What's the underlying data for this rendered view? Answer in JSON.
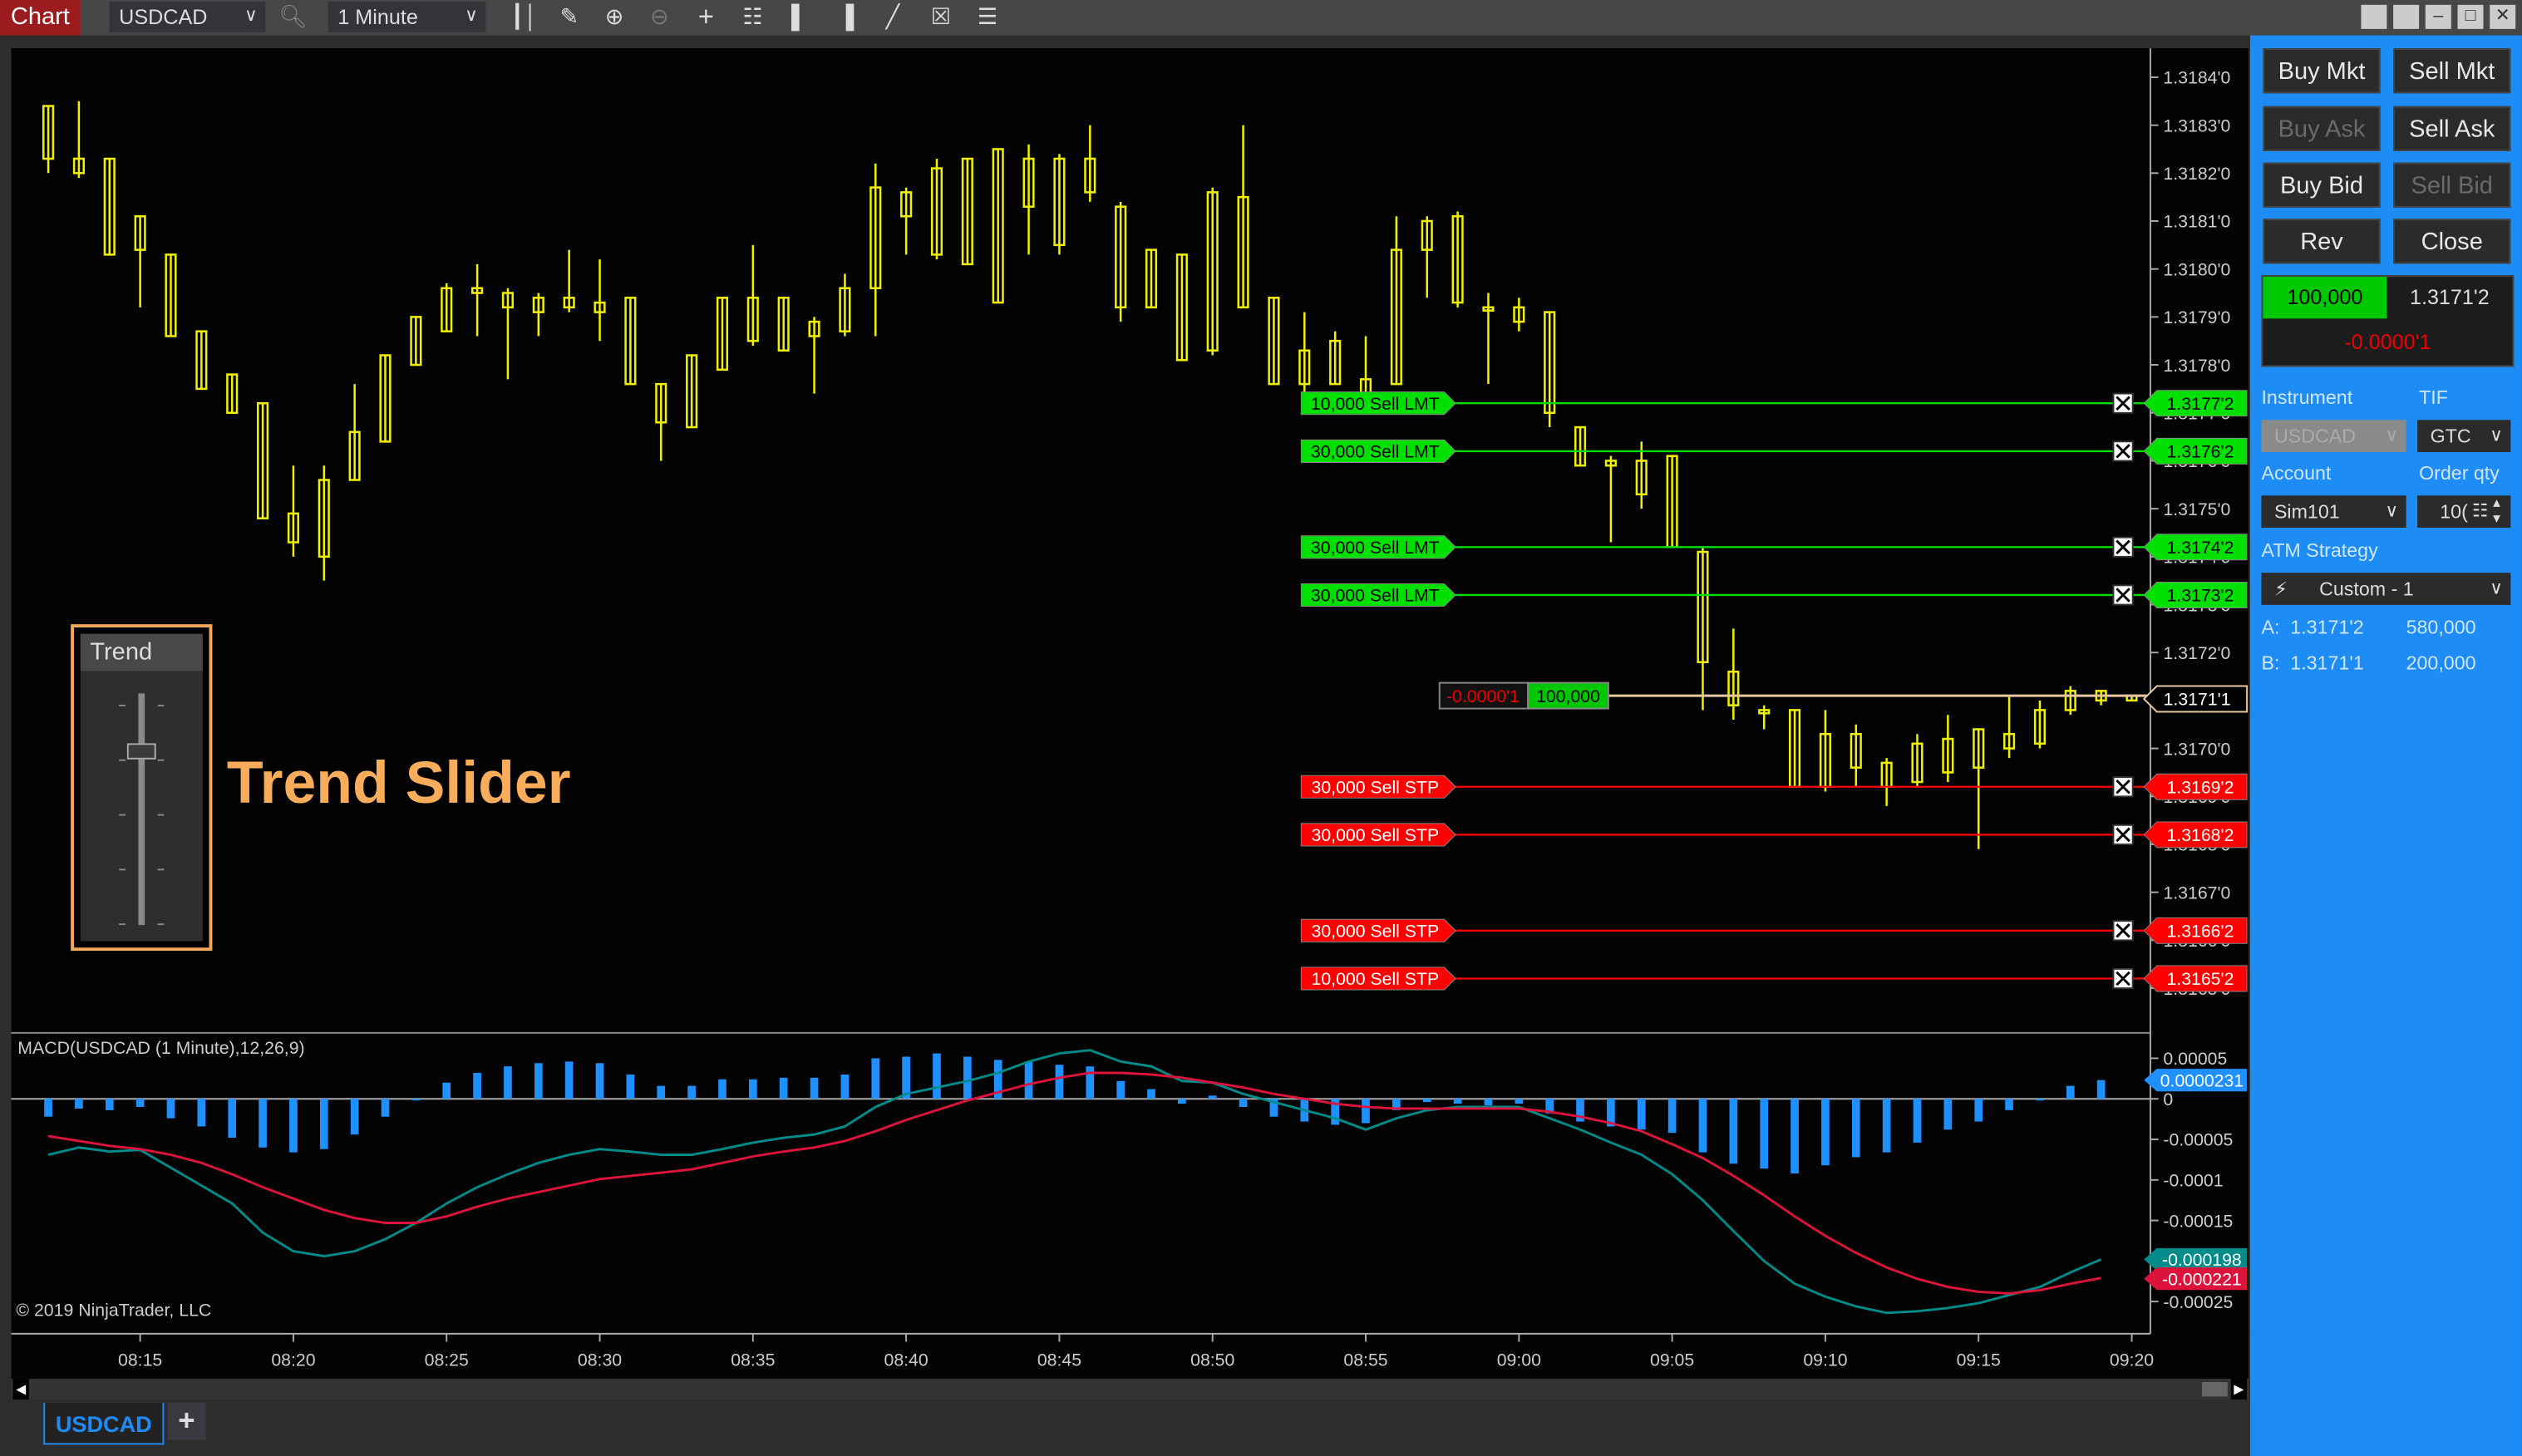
{
  "toolbar": {
    "chart_label": "Chart",
    "instrument": "USDCAD",
    "interval": "1 Minute",
    "icons": [
      "search-icon",
      "bars-type-icon",
      "drawing-tool-icon",
      "zoom-in-icon",
      "zoom-out-icon",
      "crosshair-icon",
      "properties-icon",
      "trade-panel-icon",
      "data-box-icon",
      "strategies-icon",
      "templates-icon",
      "indicator-list-icon"
    ],
    "window_buttons": [
      "tile-icon",
      "always-on-top-icon",
      "minimize-icon",
      "maximize-icon",
      "close-icon"
    ]
  },
  "colors": {
    "candle": "#f0f000",
    "sell_limit": "#00e000",
    "sell_stop": "#ff0000",
    "position_line": "#e6c8a0",
    "macd": "#008b8b",
    "signal": "#dc143c",
    "histogram": "#1e90ff",
    "panel": "#1e8cf5"
  },
  "trend_widget": {
    "title": "Trend",
    "slider_level": 0.25,
    "caption": "Trend Slider"
  },
  "chart_data": [
    {
      "type": "candlestick",
      "instrument": "USDCAD",
      "interval": "1 Minute",
      "time_start": "08:12",
      "time_ticks": [
        "08:15",
        "08:20",
        "08:25",
        "08:30",
        "08:35",
        "08:40",
        "08:45",
        "08:50",
        "08:55",
        "09:00",
        "09:05",
        "09:10",
        "09:15",
        "09:20"
      ],
      "ylim": [
        1.31645,
        1.31856
      ],
      "y_ticks": [
        "1.3184'0",
        "1.3183'0",
        "1.3182'0",
        "1.3181'0",
        "1.3180'0",
        "1.3179'0",
        "1.3178'0",
        "1.3177'0",
        "1.3176'0",
        "1.3175'0",
        "1.3174'0",
        "1.3173'0",
        "1.3172'0",
        "1.3171'0",
        "1.3170'0",
        "1.3169'0",
        "1.3168'0",
        "1.3167'0",
        "1.3166'0",
        "1.3165'0"
      ],
      "ohlc": [
        [
          1.31823,
          1.31834,
          1.3182,
          1.31834
        ],
        [
          1.3182,
          1.31835,
          1.31819,
          1.31823
        ],
        [
          1.31803,
          1.31823,
          1.31803,
          1.31823
        ],
        [
          1.31804,
          1.31811,
          1.31792,
          1.31811
        ],
        [
          1.31786,
          1.31803,
          1.31786,
          1.31803
        ],
        [
          1.31775,
          1.31787,
          1.31775,
          1.31787
        ],
        [
          1.3177,
          1.31778,
          1.3177,
          1.31778
        ],
        [
          1.31748,
          1.31772,
          1.31748,
          1.31772
        ],
        [
          1.31743,
          1.31759,
          1.3174,
          1.31749
        ],
        [
          1.3174,
          1.31759,
          1.31735,
          1.31756
        ],
        [
          1.31756,
          1.31776,
          1.31756,
          1.31766
        ],
        [
          1.31764,
          1.31782,
          1.31764,
          1.31782
        ],
        [
          1.3178,
          1.3179,
          1.3178,
          1.3179
        ],
        [
          1.31787,
          1.31797,
          1.31787,
          1.31796
        ],
        [
          1.31795,
          1.31801,
          1.31786,
          1.31796
        ],
        [
          1.31792,
          1.31796,
          1.31777,
          1.31795
        ],
        [
          1.31791,
          1.31795,
          1.31786,
          1.31794
        ],
        [
          1.31792,
          1.31804,
          1.31791,
          1.31794
        ],
        [
          1.31791,
          1.31802,
          1.31785,
          1.31793
        ],
        [
          1.31776,
          1.31794,
          1.31776,
          1.31794
        ],
        [
          1.31768,
          1.31776,
          1.3176,
          1.31776
        ],
        [
          1.31767,
          1.31782,
          1.31767,
          1.31782
        ],
        [
          1.31779,
          1.31794,
          1.31779,
          1.31794
        ],
        [
          1.31785,
          1.31805,
          1.31784,
          1.31794
        ],
        [
          1.31783,
          1.31794,
          1.31783,
          1.31794
        ],
        [
          1.31786,
          1.3179,
          1.31774,
          1.31789
        ],
        [
          1.31787,
          1.31799,
          1.31786,
          1.31796
        ],
        [
          1.31796,
          1.31822,
          1.31786,
          1.31817
        ],
        [
          1.31811,
          1.31817,
          1.31803,
          1.31816
        ],
        [
          1.31803,
          1.31823,
          1.31802,
          1.31821
        ],
        [
          1.31801,
          1.31823,
          1.31801,
          1.31823
        ],
        [
          1.31793,
          1.31825,
          1.31793,
          1.31825
        ],
        [
          1.31813,
          1.31826,
          1.31803,
          1.31823
        ],
        [
          1.31805,
          1.31824,
          1.31803,
          1.31823
        ],
        [
          1.31816,
          1.3183,
          1.31814,
          1.31823
        ],
        [
          1.31792,
          1.31814,
          1.31789,
          1.31813
        ],
        [
          1.31792,
          1.31804,
          1.31792,
          1.31804
        ],
        [
          1.31781,
          1.31803,
          1.31781,
          1.31803
        ],
        [
          1.31783,
          1.31817,
          1.31782,
          1.31816
        ],
        [
          1.31792,
          1.3183,
          1.31792,
          1.31815
        ],
        [
          1.31776,
          1.31794,
          1.31776,
          1.31794
        ],
        [
          1.31776,
          1.31791,
          1.31774,
          1.31783
        ],
        [
          1.31776,
          1.31787,
          1.31776,
          1.31785
        ],
        [
          1.31774,
          1.31786,
          1.31773,
          1.31777
        ],
        [
          1.31776,
          1.31811,
          1.31776,
          1.31804
        ],
        [
          1.31804,
          1.31811,
          1.31794,
          1.3181
        ],
        [
          1.31793,
          1.31812,
          1.31792,
          1.31811
        ],
        [
          1.31792,
          1.31795,
          1.31776,
          1.31792
        ],
        [
          1.31789,
          1.31794,
          1.31787,
          1.31792
        ],
        [
          1.3177,
          1.31791,
          1.31767,
          1.31791
        ],
        [
          1.31759,
          1.31767,
          1.31759,
          1.31767
        ],
        [
          1.31759,
          1.31761,
          1.31743,
          1.3176
        ],
        [
          1.31753,
          1.31764,
          1.3175,
          1.3176
        ],
        [
          1.31742,
          1.31761,
          1.31742,
          1.31761
        ],
        [
          1.31718,
          1.31742,
          1.31708,
          1.31741
        ],
        [
          1.31709,
          1.31725,
          1.31706,
          1.31716
        ],
        [
          1.31708,
          1.31709,
          1.31704,
          1.31708
        ],
        [
          1.31692,
          1.31708,
          1.31692,
          1.31708
        ],
        [
          1.31692,
          1.31708,
          1.31691,
          1.31703
        ],
        [
          1.31696,
          1.31705,
          1.31692,
          1.31703
        ],
        [
          1.31692,
          1.31698,
          1.31688,
          1.31697
        ],
        [
          1.31693,
          1.31703,
          1.31692,
          1.31701
        ],
        [
          1.31695,
          1.31707,
          1.31693,
          1.31702
        ],
        [
          1.31696,
          1.31704,
          1.31679,
          1.31704
        ],
        [
          1.317,
          1.31711,
          1.31698,
          1.31703
        ],
        [
          1.31701,
          1.3171,
          1.317,
          1.31708
        ],
        [
          1.31708,
          1.31713,
          1.31707,
          1.31712
        ],
        [
          1.3171,
          1.31712,
          1.31709,
          1.31712
        ],
        [
          1.3171,
          1.31711,
          1.3171,
          1.31711
        ]
      ],
      "orders": [
        {
          "qty": "10,000",
          "label": "Sell LMT",
          "price": 1.31772,
          "price_label": "1.3177'2",
          "kind": "limit"
        },
        {
          "qty": "30,000",
          "label": "Sell LMT",
          "price": 1.31762,
          "price_label": "1.3176'2",
          "kind": "limit"
        },
        {
          "qty": "30,000",
          "label": "Sell LMT",
          "price": 1.31742,
          "price_label": "1.3174'2",
          "kind": "limit"
        },
        {
          "qty": "30,000",
          "label": "Sell LMT",
          "price": 1.31732,
          "price_label": "1.3173'2",
          "kind": "limit"
        },
        {
          "qty": "30,000",
          "label": "Sell STP",
          "price": 1.31692,
          "price_label": "1.3169'2",
          "kind": "stop"
        },
        {
          "qty": "30,000",
          "label": "Sell STP",
          "price": 1.31682,
          "price_label": "1.3168'2",
          "kind": "stop"
        },
        {
          "qty": "30,000",
          "label": "Sell STP",
          "price": 1.31662,
          "price_label": "1.3166'2",
          "kind": "stop"
        },
        {
          "qty": "10,000",
          "label": "Sell STP",
          "price": 1.31652,
          "price_label": "1.3165'2",
          "kind": "stop"
        }
      ],
      "position": {
        "pnl": "-0.0000'1",
        "qty": "100,000",
        "price": 1.31711,
        "price_label": "1.3171'1"
      }
    },
    {
      "type": "line",
      "title": "MACD(USDCAD (1 Minute),12,26,9)",
      "ylim": [
        -0.00029,
        7e-05
      ],
      "y_ticks": [
        5e-05,
        0,
        -5e-05,
        -0.0001,
        -0.00015,
        -0.00025
      ],
      "y_tick_labels": [
        "0.00005",
        "0",
        "-0.00005",
        "-0.0001",
        "-0.00015",
        "-0.00025"
      ],
      "series": [
        {
          "key": "macd",
          "last_label": "-0.000198",
          "values": [
            -6.9e-05,
            -6e-05,
            -6.5e-05,
            -6.3e-05,
            -8.5e-05,
            -0.000107,
            -0.000129,
            -0.000165,
            -0.000188,
            -0.000194,
            -0.000188,
            -0.000173,
            -0.000153,
            -0.000129,
            -0.000109,
            -9.3e-05,
            -7.9e-05,
            -6.9e-05,
            -6.2e-05,
            -6.5e-05,
            -6.9e-05,
            -6.9e-05,
            -6.2e-05,
            -5.4e-05,
            -4.8e-05,
            -4.4e-05,
            -3.4e-05,
            -1e-05,
            6e-06,
            1.4e-05,
            2.2e-05,
            3.2e-05,
            4.6e-05,
            5.6e-05,
            6e-05,
            4.6e-05,
            4e-05,
            2.2e-05,
            2e-05,
            6e-06,
            -4e-06,
            -1.4e-05,
            -2.4e-05,
            -3.8e-05,
            -2.4e-05,
            -1.4e-05,
            -1e-05,
            -1e-05,
            -1e-05,
            -2.4e-05,
            -3.8e-05,
            -5.4e-05,
            -6.9e-05,
            -9.3e-05,
            -0.000125,
            -0.000163,
            -0.0002,
            -0.000228,
            -0.000244,
            -0.000256,
            -0.000264,
            -0.000262,
            -0.000258,
            -0.000252,
            -0.000242,
            -0.000232,
            -0.000214,
            -0.000198
          ]
        },
        {
          "key": "signal",
          "last_label": "-0.000221",
          "values": [
            -4.6e-05,
            -5.2e-05,
            -5.8e-05,
            -6.2e-05,
            -6.9e-05,
            -7.9e-05,
            -9.3e-05,
            -0.000109,
            -0.000123,
            -0.000137,
            -0.000147,
            -0.000153,
            -0.000153,
            -0.000145,
            -0.000133,
            -0.000123,
            -0.000115,
            -0.000107,
            -9.9e-05,
            -9.5e-05,
            -9.1e-05,
            -8.7e-05,
            -7.9e-05,
            -7.1e-05,
            -6.5e-05,
            -6e-05,
            -5.2e-05,
            -4e-05,
            -2.6e-05,
            -1.4e-05,
            -2e-06,
            8e-06,
            1.8e-05,
            2.6e-05,
            3.2e-05,
            3.2e-05,
            3e-05,
            2.6e-05,
            2e-05,
            1.4e-05,
            6e-06,
            0,
            -6e-06,
            -1e-05,
            -1.2e-05,
            -1.2e-05,
            -1.2e-05,
            -1.2e-05,
            -1.2e-05,
            -1.6e-05,
            -2.2e-05,
            -3e-05,
            -4e-05,
            -5.6e-05,
            -7.3e-05,
            -9.5e-05,
            -0.000119,
            -0.000145,
            -0.000169,
            -0.00019,
            -0.000208,
            -0.000222,
            -0.000232,
            -0.000238,
            -0.00024,
            -0.000236,
            -0.000228,
            -0.000221
          ]
        },
        {
          "key": "histogram",
          "type": "bar",
          "last_label": "0.0000231",
          "values": [
            -2.2e-05,
            -1.2e-05,
            -1.4e-05,
            -1e-05,
            -2.4e-05,
            -3.4e-05,
            -4.8e-05,
            -6e-05,
            -6.6e-05,
            -6.2e-05,
            -4.4e-05,
            -2.2e-05,
            -2e-06,
            2e-05,
            3.2e-05,
            4e-05,
            4.4e-05,
            4.6e-05,
            4.4e-05,
            3e-05,
            1.6e-05,
            1.6e-05,
            2.4e-05,
            2.4e-05,
            2.6e-05,
            2.6e-05,
            3e-05,
            5e-05,
            5.2e-05,
            5.6e-05,
            5.2e-05,
            4.8e-05,
            4.6e-05,
            4.2e-05,
            4e-05,
            2.2e-05,
            1.2e-05,
            -6e-06,
            4e-06,
            -1e-05,
            -2.2e-05,
            -2.8e-05,
            -3.2e-05,
            -3e-05,
            -1.4e-05,
            -4e-06,
            -6e-06,
            -8e-06,
            -6e-06,
            -1.8e-05,
            -2.8e-05,
            -3.4e-05,
            -3.8e-05,
            -4.2e-05,
            -6.6e-05,
            -8e-05,
            -8.6e-05,
            -9.2e-05,
            -8.2e-05,
            -7.2e-05,
            -6.6e-05,
            -5.4e-05,
            -3.8e-05,
            -2.8e-05,
            -1.4e-05,
            0,
            1.6e-05,
            2.31e-05
          ]
        }
      ]
    }
  ],
  "copyright": "© 2019 NinjaTrader, LLC",
  "chart_trader": {
    "buttons": [
      {
        "label": "Buy Mkt",
        "enabled": true
      },
      {
        "label": "Sell Mkt",
        "enabled": true
      },
      {
        "label": "Buy Ask",
        "enabled": false
      },
      {
        "label": "Sell Ask",
        "enabled": true
      },
      {
        "label": "Buy Bid",
        "enabled": true
      },
      {
        "label": "Sell Bid",
        "enabled": false
      },
      {
        "label": "Rev",
        "enabled": true
      },
      {
        "label": "Close",
        "enabled": true
      }
    ],
    "position_qty": "100,000",
    "position_price": "1.3171'2",
    "unrealized_pnl": "-0.0000'1",
    "instrument_label": "Instrument",
    "instrument_value": "USDCAD",
    "tif_label": "TIF",
    "tif_value": "GTC",
    "account_label": "Account",
    "account_value": "Sim101",
    "order_qty_label": "Order qty",
    "order_qty_value": "10(",
    "atm_label": "ATM Strategy",
    "atm_value": "Custom - 1",
    "ask_label": "A:",
    "ask_price": "1.3171'2",
    "ask_size": "580,000",
    "bid_label": "B:",
    "bid_price": "1.3171'1",
    "bid_size": "200,000"
  },
  "tabs": {
    "active": "USDCAD",
    "add": "+"
  }
}
